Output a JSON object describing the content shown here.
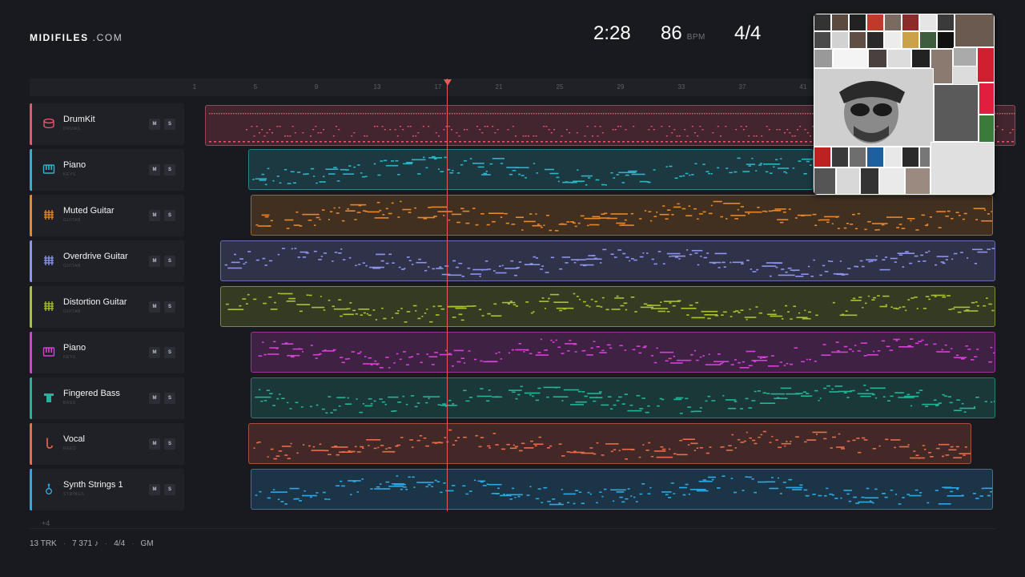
{
  "brand": {
    "name_bold": "MIDIFILES",
    "name_light": ".COM"
  },
  "hud": {
    "time": "2:28",
    "bpm": "86",
    "bpm_unit": "BPM",
    "signature": "4/4"
  },
  "ruler": {
    "ticks": [
      "1",
      "5",
      "9",
      "13",
      "17",
      "21",
      "25",
      "29",
      "33",
      "37",
      "41"
    ]
  },
  "tracks": [
    {
      "name": "DrumKit",
      "sub": "DRUMS",
      "color": "#e9546e",
      "icon": "drum-icon"
    },
    {
      "name": "Piano",
      "sub": "KEYS",
      "color": "#2bb5c9",
      "icon": "piano-icon"
    },
    {
      "name": "Muted Guitar",
      "sub": "GUITAR",
      "color": "#e8862a",
      "icon": "guitar-fretboard-icon"
    },
    {
      "name": "Overdrive Guitar",
      "sub": "GUITAR",
      "color": "#8c94ee",
      "icon": "guitar-fretboard-icon"
    },
    {
      "name": "Distortion Guitar",
      "sub": "GUITAR",
      "color": "#a8c234",
      "icon": "guitar-fretboard-icon"
    },
    {
      "name": "Piano",
      "sub": "KEYS",
      "color": "#d83fd8",
      "icon": "piano-icon"
    },
    {
      "name": "Fingered Bass",
      "sub": "BASS",
      "color": "#22b59a",
      "icon": "bass-icon"
    },
    {
      "name": "Vocal",
      "sub": "REED",
      "color": "#ec6a4a",
      "icon": "saxophone-icon"
    },
    {
      "name": "Synth Strings 1",
      "sub": "STRINGS",
      "color": "#2ea7e6",
      "icon": "strings-icon"
    }
  ],
  "buttons": {
    "mute": "M",
    "solo": "S"
  },
  "more_tracks": "+4",
  "stats": {
    "tracks": "13 TRK",
    "notes": "7 371 ♪",
    "signature": "4/4",
    "standard": "GM"
  }
}
